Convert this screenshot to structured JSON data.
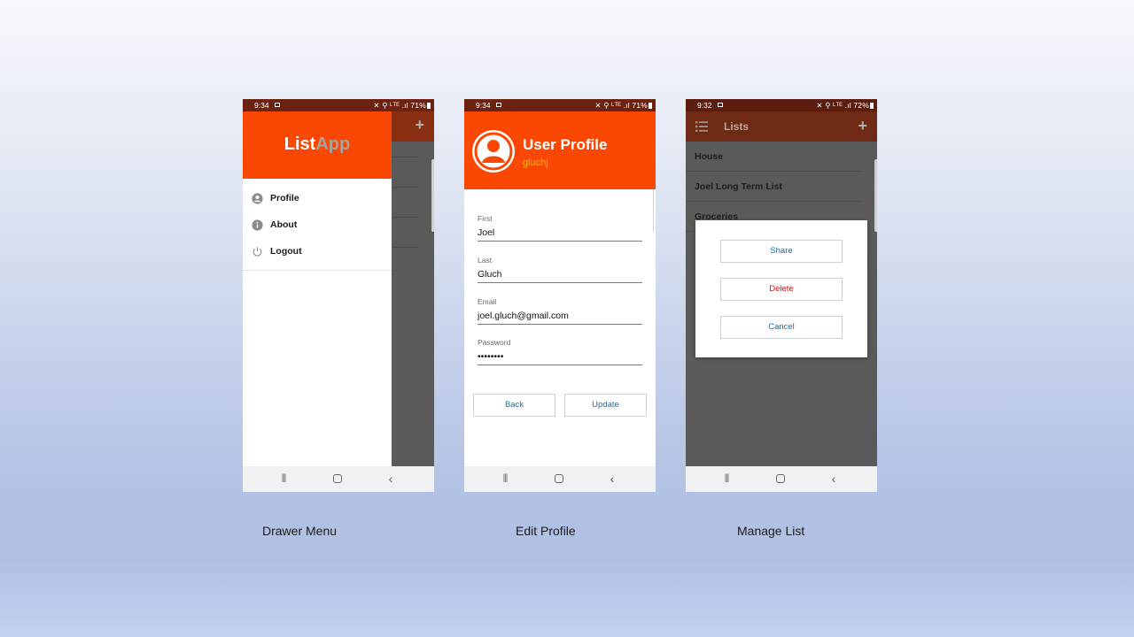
{
  "drawer_menu_screen": {
    "status_bar": {
      "time": "9:34",
      "icons": "✕ ⚲ ᴸᵀᴱ .ıl 71%"
    },
    "app_title_part1": "List",
    "app_title_part2": "App",
    "menu_items": [
      {
        "label": "Profile",
        "icon": "account-circle-icon"
      },
      {
        "label": "About",
        "icon": "info-icon"
      },
      {
        "label": "Logout",
        "icon": "power-icon"
      }
    ],
    "caption": "Drawer Menu"
  },
  "edit_profile_screen": {
    "status_bar": {
      "time": "9:34",
      "icons": "✕ ⚲ ᴸᵀᴱ .ıl 71%"
    },
    "title": "User Profile",
    "username": "gluchj",
    "fields": [
      {
        "label": "First",
        "value": "Joel"
      },
      {
        "label": "Last",
        "value": "Gluch"
      },
      {
        "label": "Email",
        "value": "joel.gluch@gmail.com"
      },
      {
        "label": "Password",
        "value": "••••••••"
      }
    ],
    "back_label": "Back",
    "update_label": "Update",
    "caption": "Edit Profile"
  },
  "manage_list_screen": {
    "status_bar": {
      "time": "9:32",
      "icons": "✕ ⚲ ᴸᵀᴱ .ıl 72%"
    },
    "title": "Lists",
    "lists": [
      {
        "label": "House"
      },
      {
        "label": "Joel Long Term List"
      },
      {
        "label": "Groceries"
      }
    ],
    "dialog": {
      "share_label": "Share",
      "delete_label": "Delete",
      "cancel_label": "Cancel"
    },
    "caption": "Manage List"
  },
  "colors": {
    "primary": "#fa4804",
    "status_bar": "#6b2210",
    "accent_text": "#1d6fa5",
    "danger": "#c01818",
    "username": "#f5c40e"
  }
}
